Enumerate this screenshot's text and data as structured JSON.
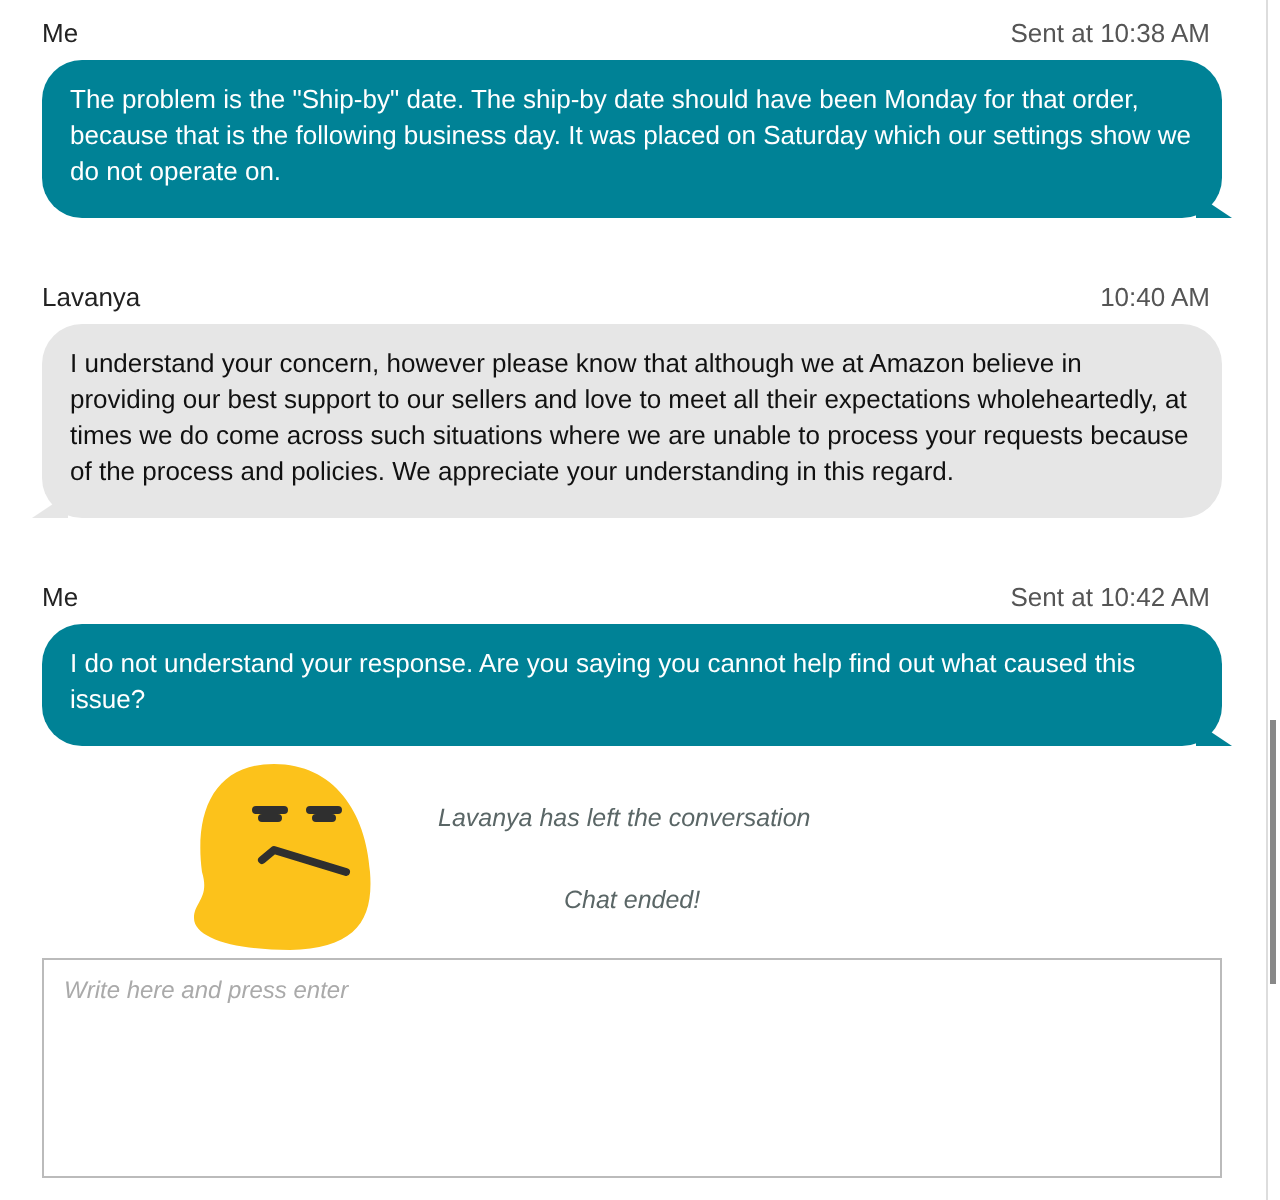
{
  "messages": [
    {
      "kind": "sent",
      "sender": "Me",
      "time": "Sent at 10:38 AM",
      "text": "The problem is the \"Ship-by\" date. The ship-by date should have been Monday for that order, because that is the following business day. It was placed on Saturday which our settings show we do not operate on."
    },
    {
      "kind": "received",
      "sender": "Lavanya",
      "time": "10:40 AM",
      "text": "I understand your concern, however please know that although we at Amazon believe in providing our best support to our sellers and love to meet all their expectations wholeheartedly, at times we do come across such situations where we are unable to process your requests because of the process and policies. We appreciate your understanding in this regard."
    },
    {
      "kind": "sent",
      "sender": "Me",
      "time": "Sent at 10:42 AM",
      "text": "I do not understand your response. Are you saying you cannot help find out what caused this issue?"
    }
  ],
  "notices": [
    "Lavanya has left the conversation",
    "Chat ended!"
  ],
  "composer": {
    "placeholder": "Write here and press enter"
  }
}
